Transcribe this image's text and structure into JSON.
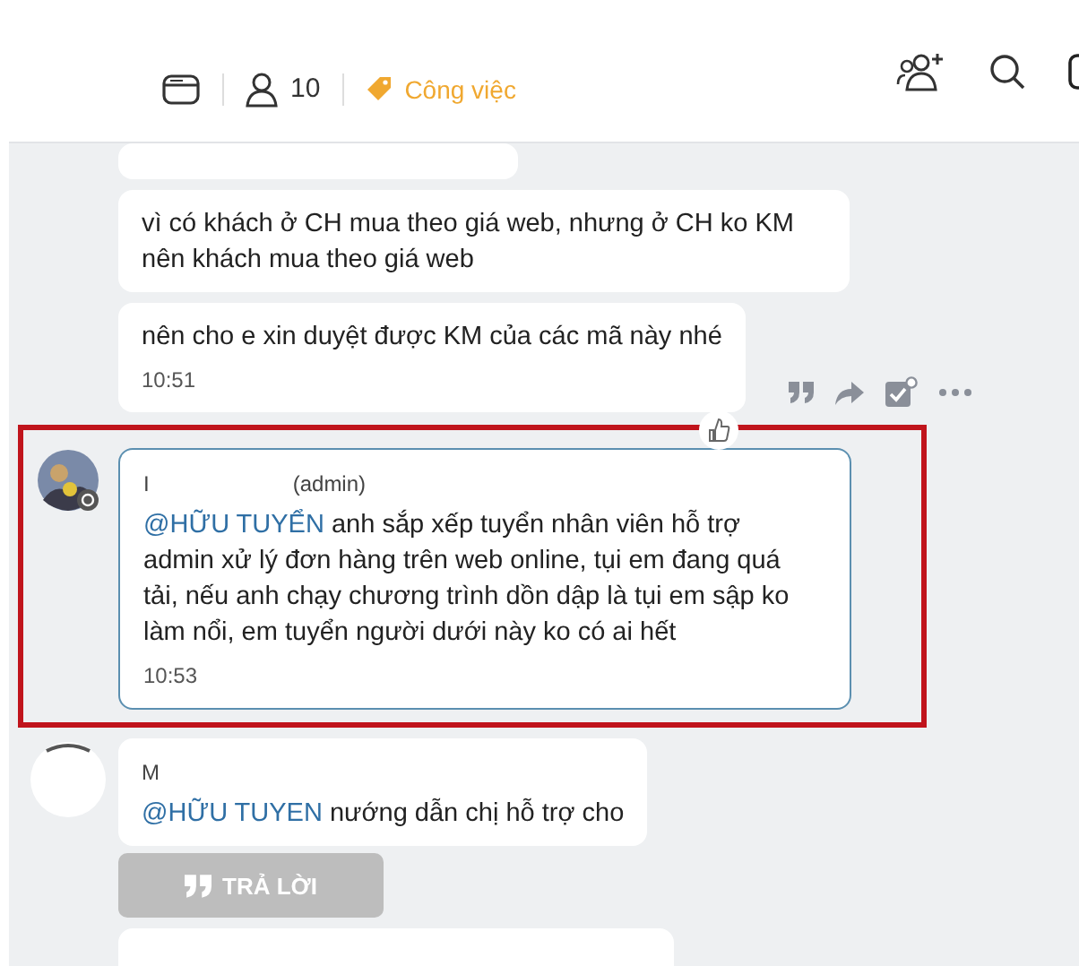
{
  "header": {
    "member_count": "10",
    "tag": "Công việc"
  },
  "messages": [
    {
      "kind": "cut"
    },
    {
      "kind": "text",
      "text": "vì có khách ở CH mua theo giá web, nhưng ở CH ko KM nên khách mua theo giá web",
      "highlighted": false,
      "show_actions": false
    },
    {
      "kind": "text",
      "text": "nên cho e xin duyệt được KM của các mã này nhé",
      "time": "10:51",
      "highlighted": false,
      "show_actions": true
    },
    {
      "kind": "text",
      "avatar": {
        "kind": "photo"
      },
      "sender": "I",
      "role": "(admin)",
      "mention": "@HỮU TUYỂN",
      "text": "anh sắp xếp tuyển nhân viên hỗ trợ admin xử lý đơn hàng trên web online, tụi em đang quá tải, nếu anh chạy chương trình dồn dập là tụi em sập ko làm nổi, em tuyển người dưới này ko có ai hết",
      "time": "10:53",
      "highlighted": true,
      "show_actions": false
    },
    {
      "kind": "text",
      "avatar": {
        "kind": "blank"
      },
      "sender": "M",
      "mention": "@HỮU TUYEN",
      "text": "nướng dẫn chị hỗ trợ cho",
      "highlighted": false,
      "show_actions": false
    },
    {
      "kind": "reply_button",
      "label": "TRẢ LỜI"
    },
    {
      "kind": "empty"
    }
  ]
}
